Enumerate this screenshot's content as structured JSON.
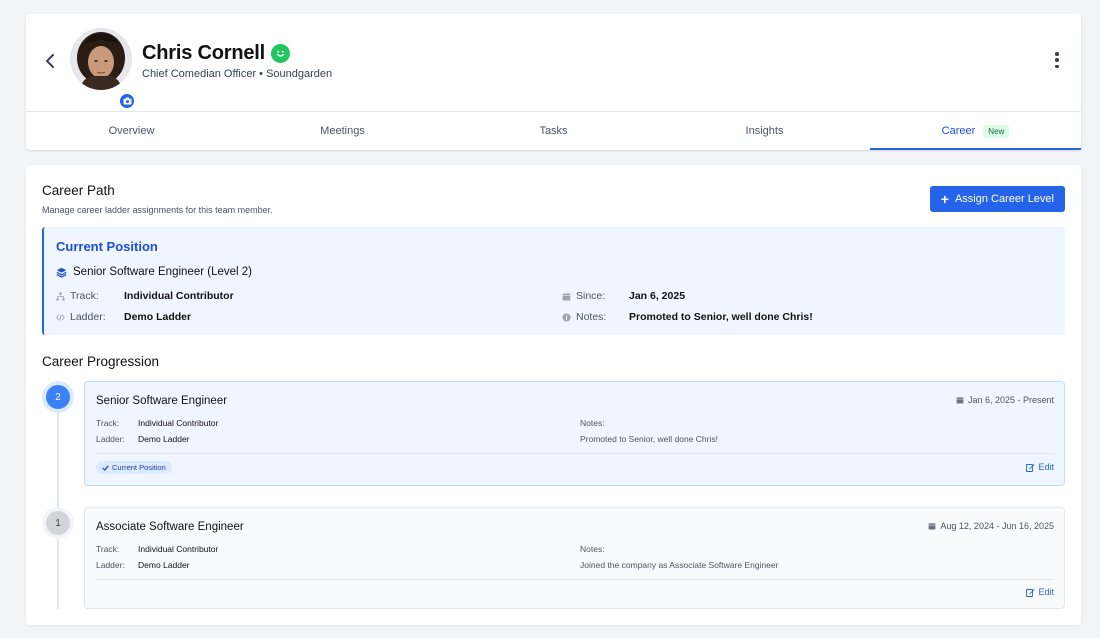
{
  "header": {
    "back_icon": "chevron-left-icon",
    "name": "Chris Cornell",
    "status_icon": "smile-icon",
    "subtitle": "Chief Comedian Officer • Soundgarden",
    "more_icon": "vertical-dots-icon",
    "avatar_badge_icon": "camera-icon"
  },
  "tabs": [
    {
      "label": "Overview"
    },
    {
      "label": "Meetings"
    },
    {
      "label": "Tasks"
    },
    {
      "label": "Insights"
    },
    {
      "label": "Career",
      "badge": "New",
      "active": true
    }
  ],
  "career": {
    "title": "Career Path",
    "description": "Manage career ladder assignments for this team member.",
    "assign_button": "Assign Career Level",
    "current": {
      "heading": "Current Position",
      "role": "Senior Software Engineer (Level 2)",
      "track_label": "Track:",
      "track_value": "Individual Contributor",
      "ladder_label": "Ladder:",
      "ladder_value": "Demo Ladder",
      "since_label": "Since:",
      "since_value": "Jan 6, 2025",
      "notes_label": "Notes:",
      "notes_value": "Promoted to Senior, well done Chris!"
    },
    "progression_title": "Career Progression",
    "progression": [
      {
        "step": "2",
        "title": "Senior Software Engineer",
        "date": "Jan 6, 2025 - Present",
        "track_label": "Track:",
        "track_value": "Individual Contributor",
        "ladder_label": "Ladder:",
        "ladder_value": "Demo Ladder",
        "notes_label": "Notes:",
        "notes_value": "Promoted to Senior, well done Chris!",
        "badge": "Current Position",
        "edit_label": "Edit"
      },
      {
        "step": "1",
        "title": "Associate Software Engineer",
        "date": "Aug 12, 2024 - Jun 16, 2025",
        "track_label": "Track:",
        "track_value": "Individual Contributor",
        "ladder_label": "Ladder:",
        "ladder_value": "Demo Ladder",
        "notes_label": "Notes:",
        "notes_value": "Joined the company as Associate Software Engineer",
        "edit_label": "Edit"
      }
    ]
  },
  "colors": {
    "accent": "#2563eb",
    "success": "#22c55e",
    "current_bg": "#eff6ff"
  }
}
